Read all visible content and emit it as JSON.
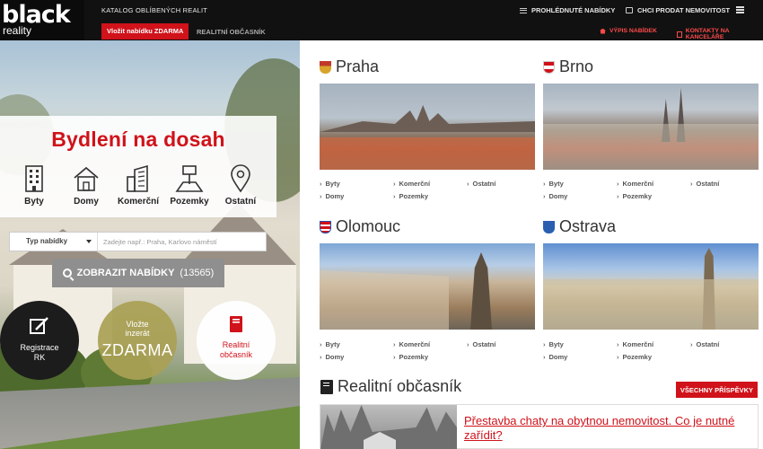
{
  "logo": {
    "main": "black",
    "sub": "reality"
  },
  "topbar": {
    "tagline": "KATALOG OBLÍBENÝCH REALIT",
    "viewed_offers": "PROHLÉDNUTÉ NABÍDKY",
    "want_sell": "CHCI PRODAT NEMOVITOST"
  },
  "subbar": {
    "post_free": "Vložit nabídku ZDARMA",
    "newspaper": "REALITNÍ OBČASNÍK",
    "offers_list": "VÝPIS NABÍDEK",
    "contacts": "KONTAKTY NA KANCELÁŘE"
  },
  "hero": {
    "headline": "Bydlení na dosah",
    "categories": [
      {
        "label": "Byty",
        "icon": "building-icon"
      },
      {
        "label": "Domy",
        "icon": "house-icon"
      },
      {
        "label": "Komerční",
        "icon": "office-building-icon"
      },
      {
        "label": "Pozemky",
        "icon": "land-plot-icon"
      },
      {
        "label": "Ostatní",
        "icon": "map-pin-icon"
      }
    ],
    "type_select": "Typ nabídky",
    "search_placeholder": "Zadejte např.: Praha, Karlovo náměstí",
    "show_button": "ZOBRAZIT NABÍDKY",
    "show_count": "(13565)",
    "circles": {
      "register_line1": "Registrace",
      "register_line2": "RK",
      "post_line1": "Vložte",
      "post_line2": "inzerát",
      "post_big": "ZDARMA",
      "paper_line1": "Realitní",
      "paper_line2": "občasník"
    }
  },
  "cities": [
    {
      "name": "Praha",
      "links": [
        "Byty",
        "Komerční",
        "Ostatní",
        "Domy",
        "Pozemky"
      ]
    },
    {
      "name": "Brno",
      "links": [
        "Byty",
        "Komerční",
        "Ostatní",
        "Domy",
        "Pozemky"
      ]
    },
    {
      "name": "Olomouc",
      "links": [
        "Byty",
        "Komerční",
        "Ostatní",
        "Domy",
        "Pozemky"
      ]
    },
    {
      "name": "Ostrava",
      "links": [
        "Byty",
        "Komerční",
        "Ostatní",
        "Domy",
        "Pozemky"
      ]
    }
  ],
  "newspaper": {
    "title": "Realitní občasník",
    "all_posts": "VŠECHNY PŘÍSPĚVKY",
    "article_title": "Přestavba chaty na obytnou nemovitost. Co je nutné zařídit?"
  },
  "colors": {
    "accent": "#d0121a",
    "topbar": "#111111"
  }
}
